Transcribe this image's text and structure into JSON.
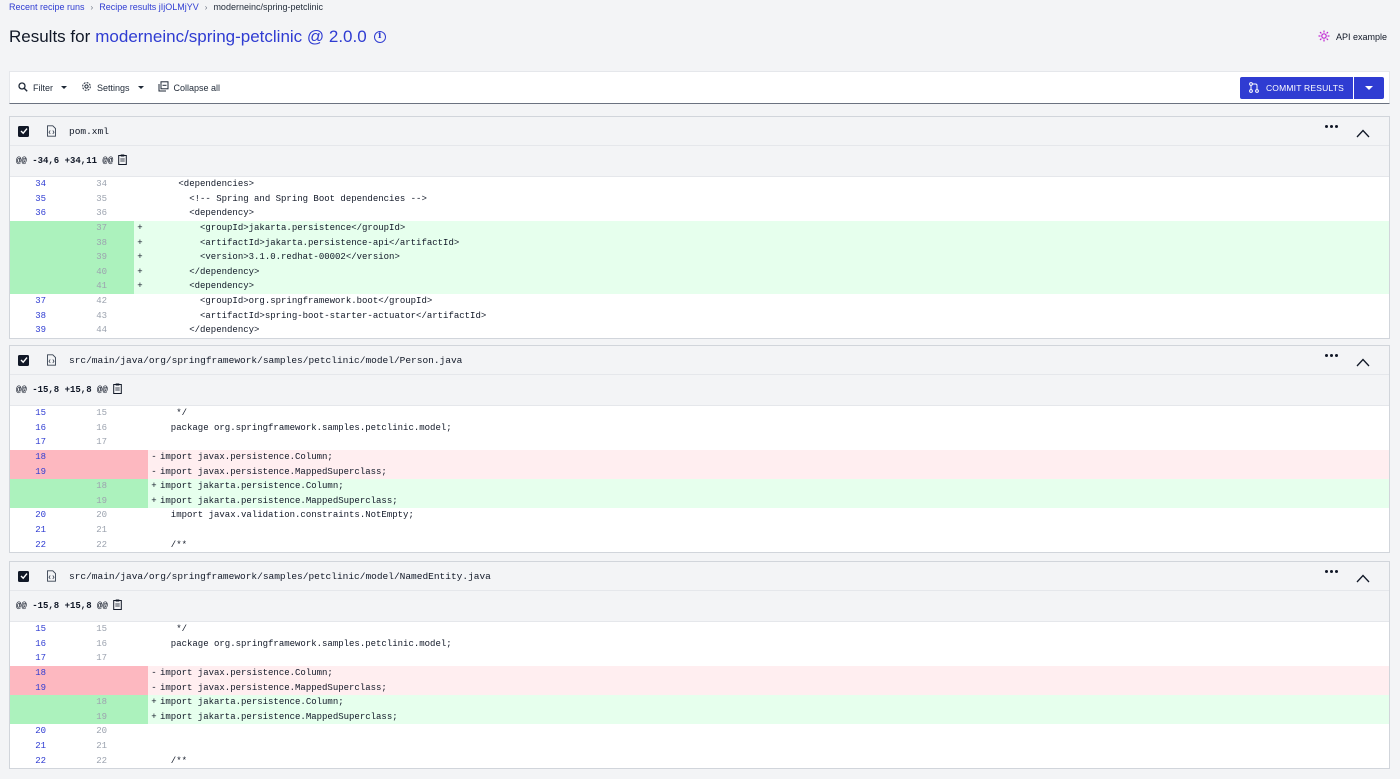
{
  "breadcrumb": {
    "item1": "Recent recipe runs",
    "item2": "Recipe results jIjOLMjYV",
    "item3": "moderneinc/spring-petclinic"
  },
  "header": {
    "prefix": "Results for",
    "repo": "moderneinc/spring-petclinic @ 2.0.0",
    "api_label": "API example"
  },
  "toolbar": {
    "filter": "Filter",
    "settings": "Settings",
    "collapse": "Collapse all",
    "commit": "COMMIT RESULTS"
  },
  "files": [
    {
      "name": "pom.xml",
      "hunk": "@@ -34,6 +34,11 @@",
      "lines": [
        {
          "o": "34",
          "n": "34",
          "t": " ",
          "c": "      <dependencies>"
        },
        {
          "o": "35",
          "n": "35",
          "t": " ",
          "c": "        <!-- Spring and Spring Boot dependencies -->"
        },
        {
          "o": "36",
          "n": "36",
          "t": " ",
          "c": "        <dependency>"
        },
        {
          "o": "",
          "n": "37",
          "t": "+",
          "c": "          <groupId>jakarta.persistence</groupId>"
        },
        {
          "o": "",
          "n": "38",
          "t": "+",
          "c": "          <artifactId>jakarta.persistence-api</artifactId>"
        },
        {
          "o": "",
          "n": "39",
          "t": "+",
          "c": "          <version>3.1.0.redhat-00002</version>"
        },
        {
          "o": "",
          "n": "40",
          "t": "+",
          "c": "        </dependency>"
        },
        {
          "o": "",
          "n": "41",
          "t": "+",
          "c": "        <dependency>"
        },
        {
          "o": "37",
          "n": "42",
          "t": " ",
          "c": "          <groupId>org.springframework.boot</groupId>"
        },
        {
          "o": "38",
          "n": "43",
          "t": " ",
          "c": "          <artifactId>spring-boot-starter-actuator</artifactId>"
        },
        {
          "o": "39",
          "n": "44",
          "t": " ",
          "c": "        </dependency>"
        }
      ]
    },
    {
      "name": "src/main/java/org/springframework/samples/petclinic/model/Person.java",
      "hunk": "@@ -15,8 +15,8 @@",
      "lines": [
        {
          "o": "15",
          "n": "15",
          "t": " ",
          "c": "   */"
        },
        {
          "o": "16",
          "n": "16",
          "t": " ",
          "c": "  package org.springframework.samples.petclinic.model;"
        },
        {
          "o": "17",
          "n": "17",
          "t": " ",
          "c": ""
        },
        {
          "o": "18",
          "n": "",
          "t": "-",
          "c": "import javax.persistence.Column;"
        },
        {
          "o": "19",
          "n": "",
          "t": "-",
          "c": "import javax.persistence.MappedSuperclass;"
        },
        {
          "o": "",
          "n": "18",
          "t": "+",
          "c": "import jakarta.persistence.Column;"
        },
        {
          "o": "",
          "n": "19",
          "t": "+",
          "c": "import jakarta.persistence.MappedSuperclass;"
        },
        {
          "o": "20",
          "n": "20",
          "t": " ",
          "c": "  import javax.validation.constraints.NotEmpty;"
        },
        {
          "o": "21",
          "n": "21",
          "t": " ",
          "c": ""
        },
        {
          "o": "22",
          "n": "22",
          "t": " ",
          "c": "  /**"
        }
      ]
    },
    {
      "name": "src/main/java/org/springframework/samples/petclinic/model/NamedEntity.java",
      "hunk": "@@ -15,8 +15,8 @@",
      "lines": [
        {
          "o": "15",
          "n": "15",
          "t": " ",
          "c": "   */"
        },
        {
          "o": "16",
          "n": "16",
          "t": " ",
          "c": "  package org.springframework.samples.petclinic.model;"
        },
        {
          "o": "17",
          "n": "17",
          "t": " ",
          "c": ""
        },
        {
          "o": "18",
          "n": "",
          "t": "-",
          "c": "import javax.persistence.Column;"
        },
        {
          "o": "19",
          "n": "",
          "t": "-",
          "c": "import javax.persistence.MappedSuperclass;"
        },
        {
          "o": "",
          "n": "18",
          "t": "+",
          "c": "import jakarta.persistence.Column;"
        },
        {
          "o": "",
          "n": "19",
          "t": "+",
          "c": "import jakarta.persistence.MappedSuperclass;"
        },
        {
          "o": "20",
          "n": "20",
          "t": " ",
          "c": ""
        },
        {
          "o": "21",
          "n": "21",
          "t": " ",
          "c": ""
        },
        {
          "o": "22",
          "n": "22",
          "t": " ",
          "c": "  /**"
        }
      ]
    }
  ],
  "icons": {
    "filter": "search-icon",
    "settings": "gear-icon",
    "collapse": "collapse-icon",
    "commit": "git-branch-icon",
    "file": "code-file-icon",
    "copy": "clipboard-icon",
    "api": "api-icon"
  },
  "colors": {
    "accent": "#2f3cd2",
    "added_bg": "#e6ffed",
    "added_gutter": "#acf2bd",
    "removed_bg": "#ffeef0",
    "removed_gutter": "#fdb8c0"
  }
}
